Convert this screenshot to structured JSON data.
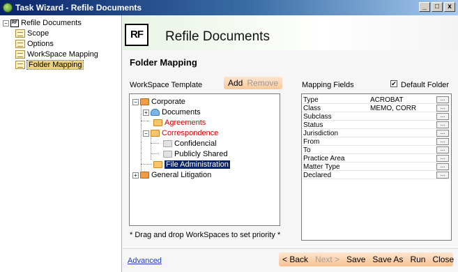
{
  "window": {
    "title": "Task Wizard - Refile Documents",
    "buttons": [
      "_",
      "□",
      "x"
    ]
  },
  "sidebar": {
    "root": "Refile Documents",
    "items": [
      "Scope",
      "Options",
      "WorkSpace Mapping",
      "Folder Mapping"
    ],
    "selected": "Folder Mapping"
  },
  "header": {
    "logo": "RF",
    "title": "Refile Documents"
  },
  "section_title": "Folder Mapping",
  "workspace": {
    "label": "WorkSpace Template",
    "add": "Add",
    "remove": "Remove",
    "tree": {
      "corporate": "Corporate",
      "documents": "Documents",
      "agreements": "Agreements",
      "correspondence": "Correspondence",
      "confidencial": "Confidencial",
      "publicly_shared": "Publicly Shared",
      "file_administration": "File Administration",
      "general_litigation": "General Litigation"
    },
    "hint": "* Drag and drop WorkSpaces to set priority *"
  },
  "mapping": {
    "label": "Mapping Fields",
    "default_folder": "Default Folder",
    "default_checked": true,
    "rows": [
      {
        "field": "Type",
        "value": "ACROBAT"
      },
      {
        "field": "Class",
        "value": "MEMO, CORR"
      },
      {
        "field": "Subclass",
        "value": ""
      },
      {
        "field": "Status",
        "value": ""
      },
      {
        "field": "Jurisdiction",
        "value": ""
      },
      {
        "field": "From",
        "value": ""
      },
      {
        "field": "To",
        "value": ""
      },
      {
        "field": "Practice Area",
        "value": ""
      },
      {
        "field": "Matter Type",
        "value": ""
      },
      {
        "field": "Declared",
        "value": ""
      }
    ],
    "row_button": "..."
  },
  "footer": {
    "advanced": "Advanced",
    "back": "< Back",
    "next": "Next >",
    "save": "Save",
    "save_as": "Save As",
    "run": "Run",
    "close": "Close"
  },
  "colors": {
    "accent_red": "#d40000",
    "selection": "#0a246a",
    "button_peach": "#f9c99a"
  }
}
